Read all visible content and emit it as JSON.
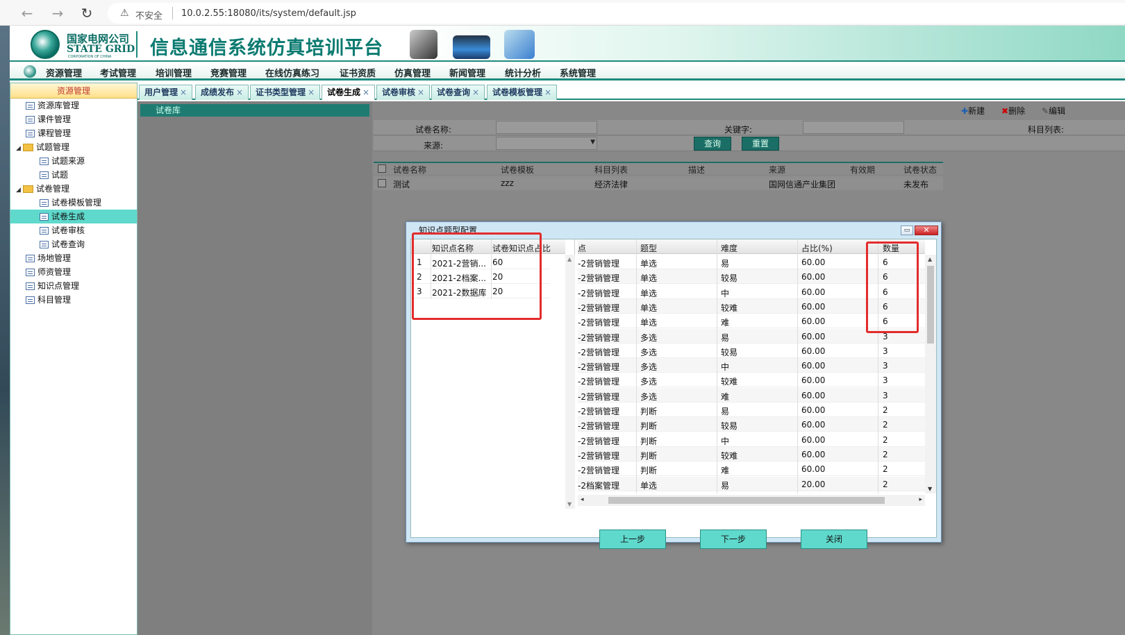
{
  "browser": {
    "insecure_label": "不安全",
    "url": "10.0.2.55:18080/its/system/default.jsp"
  },
  "header": {
    "logo_cn": "国家电网公司",
    "logo_en": "STATE GRID",
    "logo_en_sub": "CORPORATION OF CHINA",
    "app_title": "信息通信系统仿真培训平台"
  },
  "menu": [
    "资源管理",
    "考试管理",
    "培训管理",
    "竞赛管理",
    "在线仿真练习",
    "证书资质",
    "仿真管理",
    "新闻管理",
    "统计分析",
    "系统管理"
  ],
  "left_panel": {
    "title": "资源管理",
    "items": [
      {
        "label": "资源库管理",
        "level": 0,
        "kind": "page"
      },
      {
        "label": "课件管理",
        "level": 0,
        "kind": "page"
      },
      {
        "label": "课程管理",
        "level": 0,
        "kind": "page"
      },
      {
        "label": "试题管理",
        "level": 0,
        "kind": "folder"
      },
      {
        "label": "试题来源",
        "level": 1,
        "kind": "page"
      },
      {
        "label": "试题",
        "level": 1,
        "kind": "page"
      },
      {
        "label": "试卷管理",
        "level": 0,
        "kind": "folder"
      },
      {
        "label": "试卷模板管理",
        "level": 1,
        "kind": "page"
      },
      {
        "label": "试卷生成",
        "level": 1,
        "kind": "page",
        "selected": true
      },
      {
        "label": "试卷审核",
        "level": 1,
        "kind": "page"
      },
      {
        "label": "试卷查询",
        "level": 1,
        "kind": "page"
      },
      {
        "label": "场地管理",
        "level": 0,
        "kind": "page"
      },
      {
        "label": "师资管理",
        "level": 0,
        "kind": "page"
      },
      {
        "label": "知识点管理",
        "level": 0,
        "kind": "page"
      },
      {
        "label": "科目管理",
        "level": 0,
        "kind": "page"
      }
    ]
  },
  "tabs": [
    "用户管理",
    "成绩发布",
    "证书类型管理",
    "试卷生成",
    "试卷审核",
    "试卷查询",
    "试卷模板管理"
  ],
  "tab_close": "×",
  "active_tab": "试卷生成",
  "tree_root": "试卷库",
  "toolbar": {
    "new": "新建",
    "delete": "删除",
    "edit": "编辑"
  },
  "filters": {
    "paper_name": "试卷名称:",
    "keyword": "关键字:",
    "subject_list": "科目列表:",
    "source": "来源:",
    "query": "查询",
    "reset": "重置"
  },
  "grid": {
    "columns": [
      "试卷名称",
      "试卷模板",
      "科目列表",
      "描述",
      "来源",
      "有效期",
      "试卷状态"
    ],
    "rows": [
      [
        "测试",
        "zzz",
        "经济法律",
        "",
        "国网信通产业集团",
        "",
        "未发布"
      ]
    ]
  },
  "dialog": {
    "title": "知识点题型配置",
    "left_columns": [
      "知识点名称",
      "试卷知识点占比"
    ],
    "left_rows": [
      [
        "1",
        "2021-2营销...",
        "60"
      ],
      [
        "2",
        "2021-2档案...",
        "20"
      ],
      [
        "3",
        "2021-2数据库",
        "20"
      ]
    ],
    "right_columns": [
      "点",
      "题型",
      "难度",
      "占比(%)",
      "数量"
    ],
    "right_rows": [
      [
        "-2营销管理",
        "单选",
        "易",
        "60.00",
        "6"
      ],
      [
        "-2营销管理",
        "单选",
        "较易",
        "60.00",
        "6"
      ],
      [
        "-2营销管理",
        "单选",
        "中",
        "60.00",
        "6"
      ],
      [
        "-2营销管理",
        "单选",
        "较难",
        "60.00",
        "6"
      ],
      [
        "-2营销管理",
        "单选",
        "难",
        "60.00",
        "6"
      ],
      [
        "-2营销管理",
        "多选",
        "易",
        "60.00",
        "3"
      ],
      [
        "-2营销管理",
        "多选",
        "较易",
        "60.00",
        "3"
      ],
      [
        "-2营销管理",
        "多选",
        "中",
        "60.00",
        "3"
      ],
      [
        "-2营销管理",
        "多选",
        "较难",
        "60.00",
        "3"
      ],
      [
        "-2营销管理",
        "多选",
        "难",
        "60.00",
        "3"
      ],
      [
        "-2营销管理",
        "判断",
        "易",
        "60.00",
        "2"
      ],
      [
        "-2营销管理",
        "判断",
        "较易",
        "60.00",
        "2"
      ],
      [
        "-2营销管理",
        "判断",
        "中",
        "60.00",
        "2"
      ],
      [
        "-2营销管理",
        "判断",
        "较难",
        "60.00",
        "2"
      ],
      [
        "-2营销管理",
        "判断",
        "难",
        "60.00",
        "2"
      ],
      [
        "-2档案管理",
        "单选",
        "易",
        "20.00",
        "2"
      ]
    ],
    "btn_prev": "上一步",
    "btn_next": "下一步",
    "btn_close": "关闭"
  }
}
